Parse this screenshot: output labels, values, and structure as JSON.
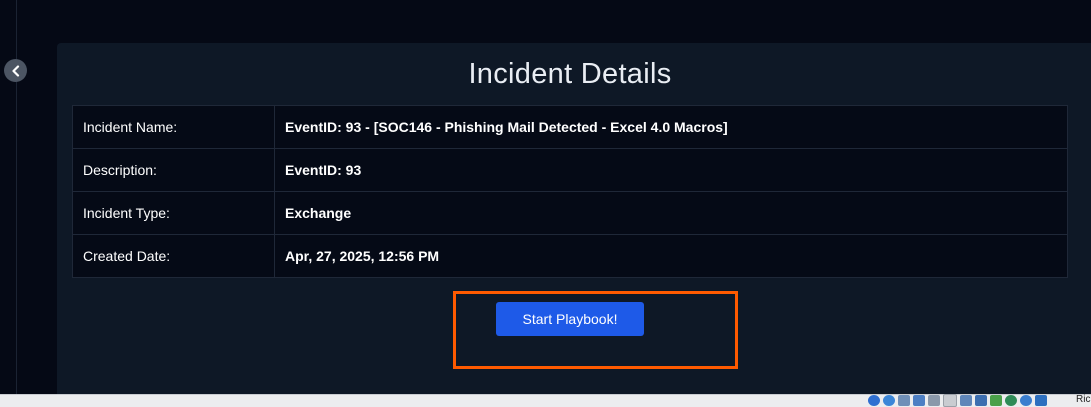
{
  "panel": {
    "title": "Incident Details"
  },
  "details": [
    {
      "label": "Incident Name:",
      "value": "EventID: 93 - [SOC146 - Phishing Mail Detected - Excel 4.0 Macros]"
    },
    {
      "label": "Description:",
      "value": "EventID: 93"
    },
    {
      "label": "Incident Type:",
      "value": "Exchange"
    },
    {
      "label": "Created Date:",
      "value": "Apr, 27, 2025, 12:56 PM"
    }
  ],
  "actions": {
    "start_playbook_label": "Start Playbook!"
  },
  "taskbar": {
    "tray_text": "Ric",
    "tray_icons": [
      "help-icon",
      "globe-icon",
      "network-icon",
      "display-icon",
      "pen-icon",
      "clipboard-icon",
      "window-icon",
      "monitor-icon",
      "usb-icon",
      "shield-icon",
      "refresh-icon",
      "download-icon"
    ]
  },
  "colors": {
    "background": "#050915",
    "panel": "#0e1826",
    "accent_button": "#1e5ae8",
    "highlight": "#ff5a00"
  }
}
